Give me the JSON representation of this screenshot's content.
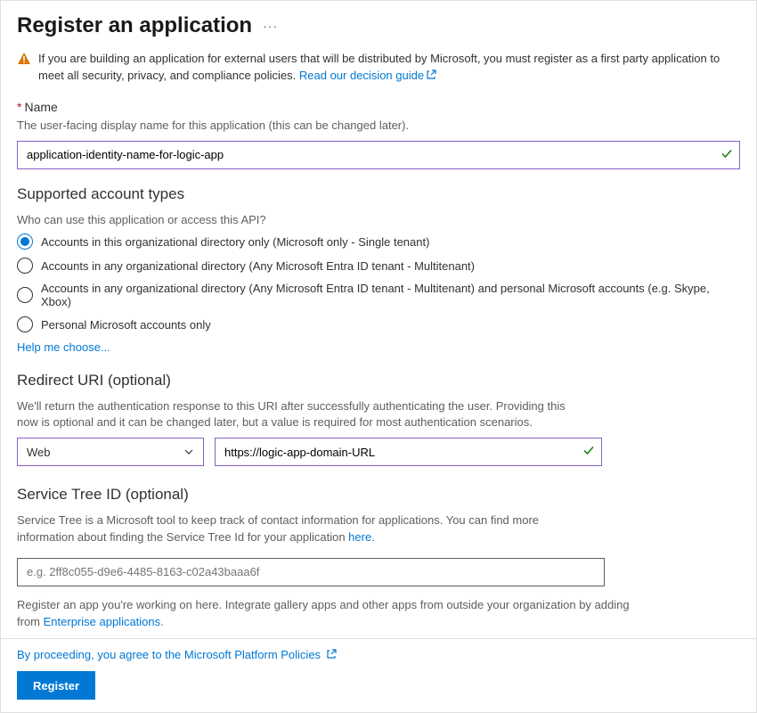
{
  "header": {
    "title": "Register an application"
  },
  "warning": {
    "text": "If you are building an application for external users that will be distributed by Microsoft, you must register as a first party application to meet all security, privacy, and compliance policies.",
    "link_text": "Read our decision guide"
  },
  "name_section": {
    "label": "Name",
    "description": "The user-facing display name for this application (this can be changed later).",
    "value": "application-identity-name-for-logic-app"
  },
  "account_types": {
    "heading": "Supported account types",
    "question": "Who can use this application or access this API?",
    "options": [
      "Accounts in this organizational directory only (Microsoft only - Single tenant)",
      "Accounts in any organizational directory (Any Microsoft Entra ID tenant - Multitenant)",
      "Accounts in any organizational directory (Any Microsoft Entra ID tenant - Multitenant) and personal Microsoft accounts (e.g. Skype, Xbox)",
      "Personal Microsoft accounts only"
    ],
    "selected_index": 0,
    "help_link": "Help me choose..."
  },
  "redirect": {
    "heading": "Redirect URI (optional)",
    "description": "We'll return the authentication response to this URI after successfully authenticating the user. Providing this now is optional and it can be changed later, but a value is required for most authentication scenarios.",
    "platform_selected": "Web",
    "uri_value": "https://logic-app-domain-URL"
  },
  "service_tree": {
    "heading": "Service Tree ID (optional)",
    "description_prefix": "Service Tree is a Microsoft tool to keep track of contact information for applications. You can find more information about finding the Service Tree Id for your application ",
    "description_link": "here",
    "placeholder": "e.g. 2ff8c055-d9e6-4485-8163-c02a43baaa6f"
  },
  "register_note": {
    "prefix": "Register an app you're working on here. Integrate gallery apps and other apps from outside your organization by adding from ",
    "link": "Enterprise applications"
  },
  "footer": {
    "policy_text": "By proceeding, you agree to the Microsoft Platform Policies",
    "register_button": "Register"
  }
}
